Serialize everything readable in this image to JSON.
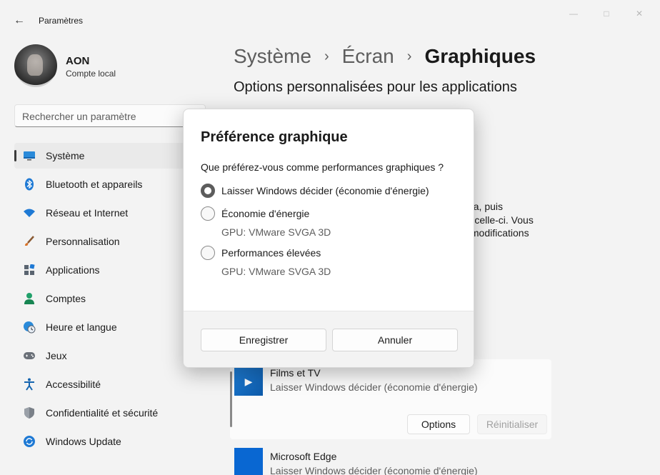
{
  "window": {
    "title": "Paramètres",
    "back_icon": "arrow-left-icon"
  },
  "user": {
    "name": "AON",
    "account_type": "Compte local"
  },
  "search": {
    "placeholder": "Rechercher un paramètre"
  },
  "sidebar": {
    "items": [
      {
        "label": "Système",
        "icon": "display-icon",
        "active": true
      },
      {
        "label": "Bluetooth et appareils",
        "icon": "bluetooth-icon"
      },
      {
        "label": "Réseau et Internet",
        "icon": "wifi-icon"
      },
      {
        "label": "Personnalisation",
        "icon": "brush-icon"
      },
      {
        "label": "Applications",
        "icon": "apps-icon"
      },
      {
        "label": "Comptes",
        "icon": "person-icon"
      },
      {
        "label": "Heure et langue",
        "icon": "globe-clock-icon"
      },
      {
        "label": "Jeux",
        "icon": "gamepad-icon"
      },
      {
        "label": "Accessibilité",
        "icon": "accessibility-icon"
      },
      {
        "label": "Confidentialité et sécurité",
        "icon": "shield-icon"
      },
      {
        "label": "Windows Update",
        "icon": "update-icon"
      }
    ]
  },
  "breadcrumb": {
    "items": [
      "Système",
      "Écran",
      "Graphiques"
    ]
  },
  "main": {
    "section_title": "Options personnalisées pour les applications",
    "partial_text": [
      "z-la, puis",
      "ur celle-ci. Vous",
      "s modifications"
    ],
    "apps": [
      {
        "name": "Films et TV",
        "preference": "Laisser Windows décider (économie d'énergie)"
      },
      {
        "name": "Microsoft Edge",
        "preference": "Laisser Windows décider (économie d'énergie)"
      }
    ],
    "options_label": "Options",
    "reset_label": "Réinitialiser"
  },
  "dialog": {
    "title": "Préférence graphique",
    "question": "Que préférez-vous comme performances graphiques ?",
    "options": [
      {
        "label": "Laisser Windows décider (économie d'énergie)",
        "sub": "",
        "checked": true
      },
      {
        "label": "Économie d'énergie",
        "sub": "GPU: VMware SVGA 3D",
        "checked": false
      },
      {
        "label": "Performances élevées",
        "sub": "GPU: VMware SVGA 3D",
        "checked": false
      }
    ],
    "save_label": "Enregistrer",
    "cancel_label": "Annuler"
  }
}
